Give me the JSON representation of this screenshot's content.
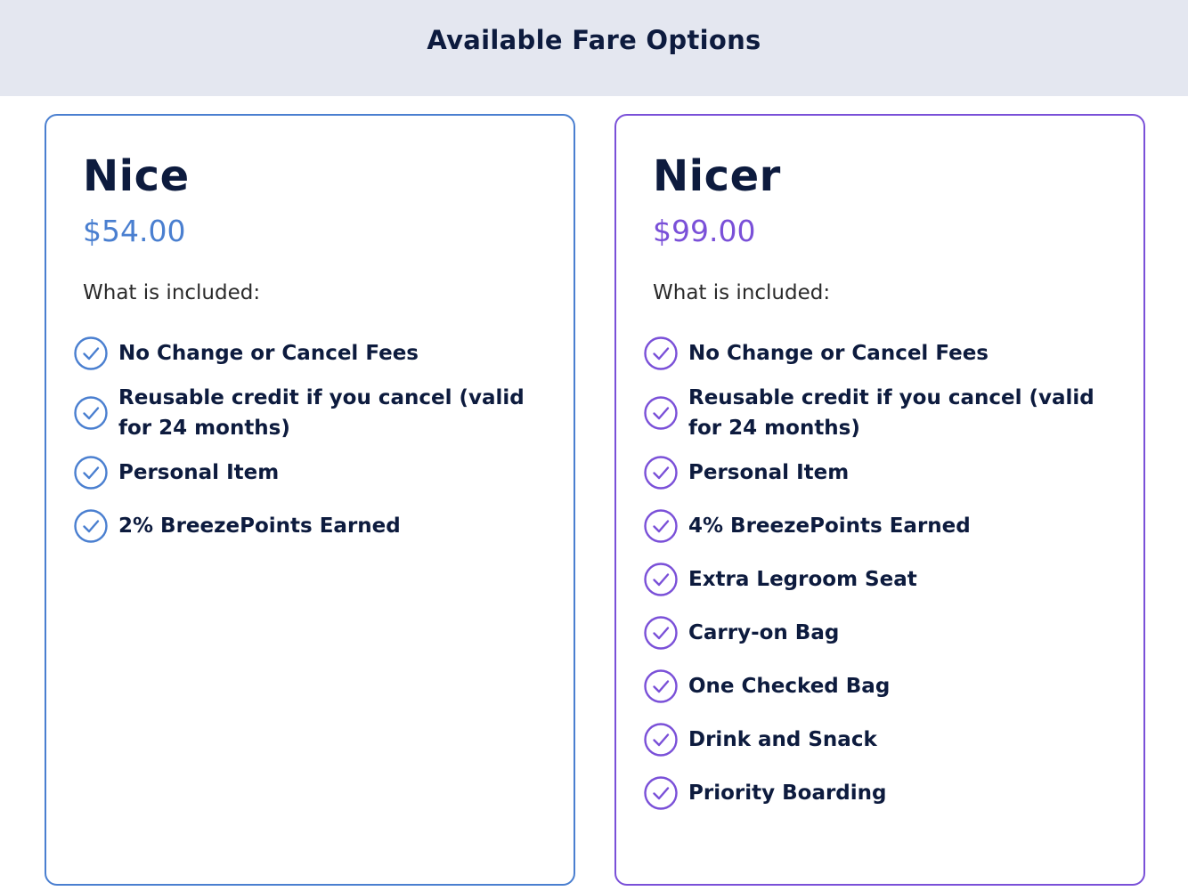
{
  "header": {
    "title": "Available Fare Options"
  },
  "colors": {
    "nice_accent": "#4a7fd0",
    "nicer_accent": "#7a50d8",
    "text_dark": "#0d1b3e",
    "header_bg": "#e4e7f0"
  },
  "fares": [
    {
      "name": "Nice",
      "price": "$54.00",
      "included_label": "What is included:",
      "features": [
        "No Change or Cancel Fees",
        "Reusable credit if you cancel (valid for 24 months)",
        "Personal Item",
        "2% BreezePoints Earned"
      ]
    },
    {
      "name": "Nicer",
      "price": "$99.00",
      "included_label": "What is included:",
      "features": [
        "No Change or Cancel Fees",
        "Reusable credit if you cancel (valid for 24 months)",
        "Personal Item",
        "4% BreezePoints Earned",
        "Extra Legroom Seat",
        "Carry-on Bag",
        "One Checked Bag",
        "Drink and Snack",
        "Priority Boarding"
      ]
    }
  ],
  "icons": {
    "feature_icon": "check-circle-icon"
  }
}
